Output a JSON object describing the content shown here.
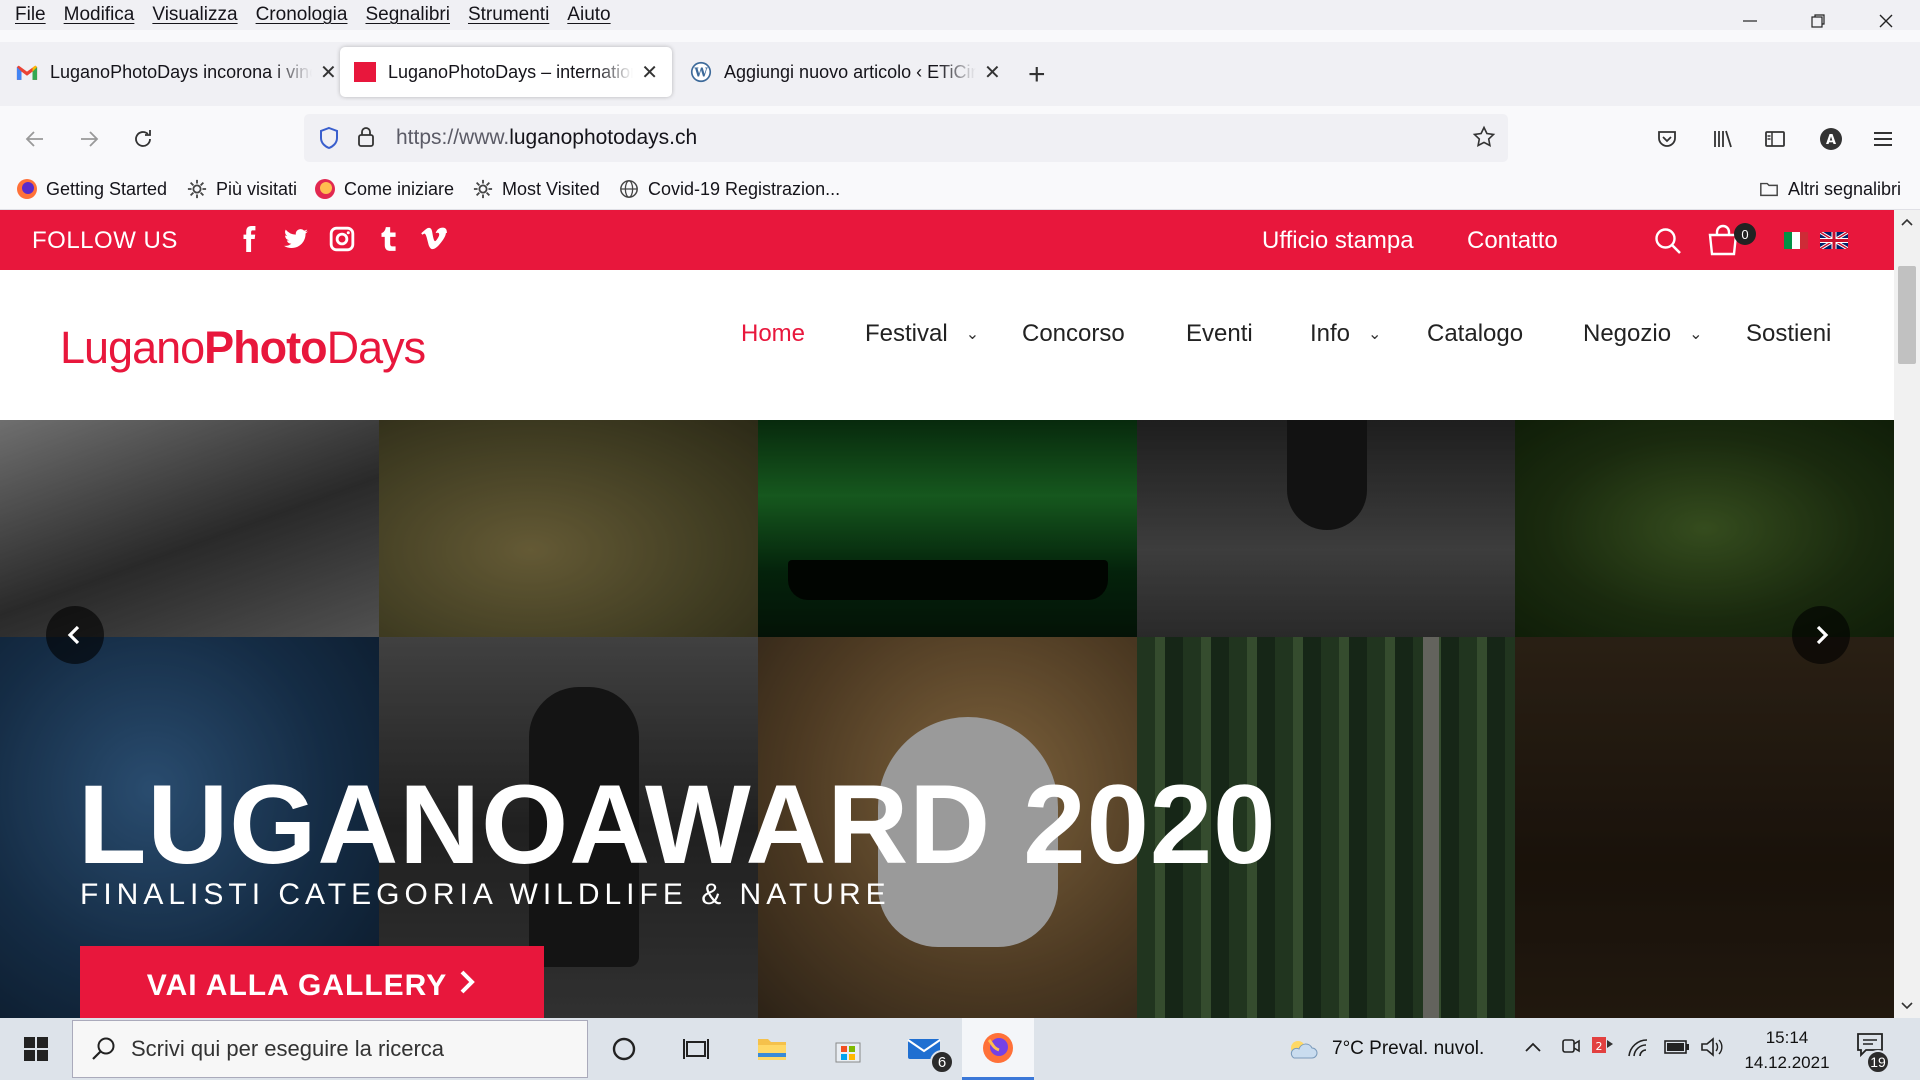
{
  "menu": [
    "File",
    "Modifica",
    "Visualizza",
    "Cronologia",
    "Segnalibri",
    "Strumenti",
    "Aiuto"
  ],
  "tabs": [
    {
      "title": "LuganoPhotoDays incorona i vincitori",
      "icon": "gmail-icon",
      "active": false
    },
    {
      "title": "LuganoPhotoDays – international photography festival",
      "icon": "lpd-favicon",
      "active": true
    },
    {
      "title": "Aggiungi nuovo articolo ‹ ETiCinforma",
      "icon": "wordpress-icon",
      "active": false
    }
  ],
  "url": {
    "prefix": "https://www.",
    "domain": "luganophotodays.ch"
  },
  "bookmarks": [
    "Getting Started",
    "Più visitati",
    "Come iniziare",
    "Most Visited",
    "Covid-19 Registrazion...",
    "Altri segnalibri"
  ],
  "site": {
    "follow": "FOLLOW US",
    "social": [
      "facebook-icon",
      "twitter-icon",
      "instagram-icon",
      "tumblr-icon",
      "vimeo-icon"
    ],
    "toplinks": [
      "Ufficio stampa",
      "Contatto"
    ],
    "cart_count": "0",
    "logo": {
      "a": "Lugano",
      "b": "Photo",
      "c": "Days"
    },
    "nav": [
      "Home",
      "Festival",
      "Concorso",
      "Eventi",
      "Info",
      "Catalogo",
      "Negozio",
      "Sostieni"
    ],
    "hero": {
      "title": "LUGANOAWARD 2020",
      "subtitle": "FINALISTI CATEGORIA WILDLIFE & NATURE",
      "cta": "VAI ALLA GALLERY"
    },
    "accent": "#e8173c"
  },
  "taskbar": {
    "search": "Scrivi qui per eseguire la ricerca",
    "mail_badge": "6",
    "weather": "7°C  Preval. nuvol.",
    "time": "15:14",
    "date": "14.12.2021",
    "notif": "19"
  }
}
